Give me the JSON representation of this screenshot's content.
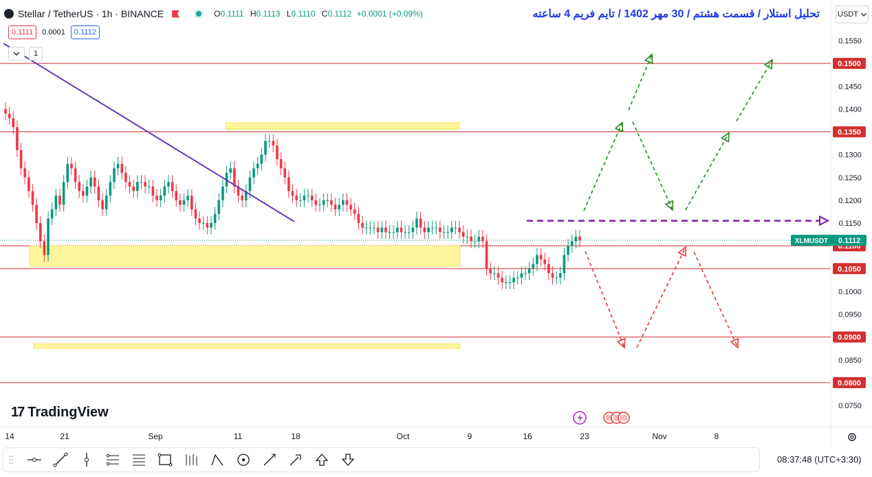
{
  "header": {
    "symbol": "Stellar / TetherUS · 1h · BINANCE",
    "ohlc": {
      "o_label": "O",
      "o": "0.1111",
      "h_label": "H",
      "h": "0.1113",
      "l_label": "L",
      "l": "0.1110",
      "c_label": "C",
      "c": "0.1112",
      "change": "+0.0001 (+0.09%)"
    }
  },
  "order": {
    "sell": "0.1111",
    "spread": "0.0001",
    "buy": "0.1112"
  },
  "indicator_count": "1",
  "title_fa": "تحلیل استلار / قسمت هشتم / 30 مهر 1402 / تایم فریم 4 ساعته",
  "currency": "USDT",
  "brand": "TradingView",
  "brand_mark": "17",
  "clock": "08:37:48",
  "timezone": "(UTC+3:30)",
  "colors": {
    "up": "#089981",
    "down": "#f23645",
    "level_line": "#d32f2f",
    "zone": "#fff59d",
    "trend": "#673ab7",
    "green_path": "#1e8c1e",
    "red_path": "#e53935",
    "purple_dash": "#7b1fa2"
  },
  "toolbar_icons": [
    "horizontal-ray-icon",
    "trend-line-icon",
    "vertical-line-icon",
    "parallel-channel-icon",
    "fib-retracement-icon",
    "rectangle-icon",
    "long-position-icon",
    "pattern-icon",
    "circle-icon",
    "brush-icon",
    "arrow-icon",
    "arrow-up-icon",
    "arrow-down-icon"
  ],
  "chart_data": {
    "type": "candlestick",
    "symbol_label": "XLMUSDT",
    "last_price": 0.1112,
    "x_ticks": [
      "14",
      "21",
      "Sep",
      "11",
      "18",
      "Oct",
      "9",
      "16",
      "23",
      "Nov",
      "8"
    ],
    "y_ticks": [
      "0.1550",
      "0.1450",
      "0.1400",
      "0.1300",
      "0.1250",
      "0.1200",
      "0.1150",
      "0.1000",
      "0.0950",
      "0.0850",
      "0.0750"
    ],
    "levels": [
      {
        "price": 0.15,
        "label": "0.1500"
      },
      {
        "price": 0.135,
        "label": "0.1350"
      },
      {
        "price": 0.11,
        "label": "0.1100"
      },
      {
        "price": 0.105,
        "label": "0.1050"
      },
      {
        "price": 0.09,
        "label": "0.0900"
      },
      {
        "price": 0.08,
        "label": "0.0800"
      }
    ],
    "ylim": [
      0.0725,
      0.1575
    ],
    "close_series": [
      0.139,
      0.138,
      0.136,
      0.131,
      0.127,
      0.125,
      0.122,
      0.119,
      0.115,
      0.111,
      0.108,
      0.116,
      0.118,
      0.121,
      0.119,
      0.124,
      0.128,
      0.127,
      0.124,
      0.122,
      0.121,
      0.123,
      0.125,
      0.123,
      0.12,
      0.118,
      0.121,
      0.124,
      0.127,
      0.128,
      0.126,
      0.124,
      0.123,
      0.122,
      0.124,
      0.124,
      0.123,
      0.123,
      0.121,
      0.12,
      0.121,
      0.123,
      0.124,
      0.122,
      0.12,
      0.119,
      0.12,
      0.121,
      0.118,
      0.116,
      0.115,
      0.115,
      0.114,
      0.115,
      0.117,
      0.12,
      0.123,
      0.126,
      0.127,
      0.123,
      0.121,
      0.12,
      0.122,
      0.125,
      0.127,
      0.128,
      0.13,
      0.133,
      0.133,
      0.132,
      0.129,
      0.127,
      0.125,
      0.122,
      0.121,
      0.12,
      0.12,
      0.121,
      0.121,
      0.12,
      0.119,
      0.119,
      0.12,
      0.12,
      0.119,
      0.118,
      0.119,
      0.12,
      0.119,
      0.118,
      0.117,
      0.115,
      0.114,
      0.114,
      0.114,
      0.114,
      0.113,
      0.114,
      0.113,
      0.113,
      0.113,
      0.114,
      0.113,
      0.113,
      0.113,
      0.114,
      0.116,
      0.114,
      0.113,
      0.114,
      0.114,
      0.114,
      0.113,
      0.113,
      0.113,
      0.114,
      0.114,
      0.113,
      0.112,
      0.112,
      0.111,
      0.111,
      0.112,
      0.111,
      0.105,
      0.104,
      0.104,
      0.103,
      0.102,
      0.102,
      0.102,
      0.103,
      0.103,
      0.104,
      0.104,
      0.105,
      0.106,
      0.108,
      0.107,
      0.106,
      0.104,
      0.103,
      0.103,
      0.104,
      0.108,
      0.11,
      0.111,
      0.112,
      0.1112
    ],
    "zones": [
      {
        "top": 0.137,
        "bottom": 0.1355
      },
      {
        "top": 0.11,
        "bottom": 0.1055
      },
      {
        "top": 0.0885,
        "bottom": 0.0875
      }
    ],
    "key_level_dashed": 0.1155
  }
}
